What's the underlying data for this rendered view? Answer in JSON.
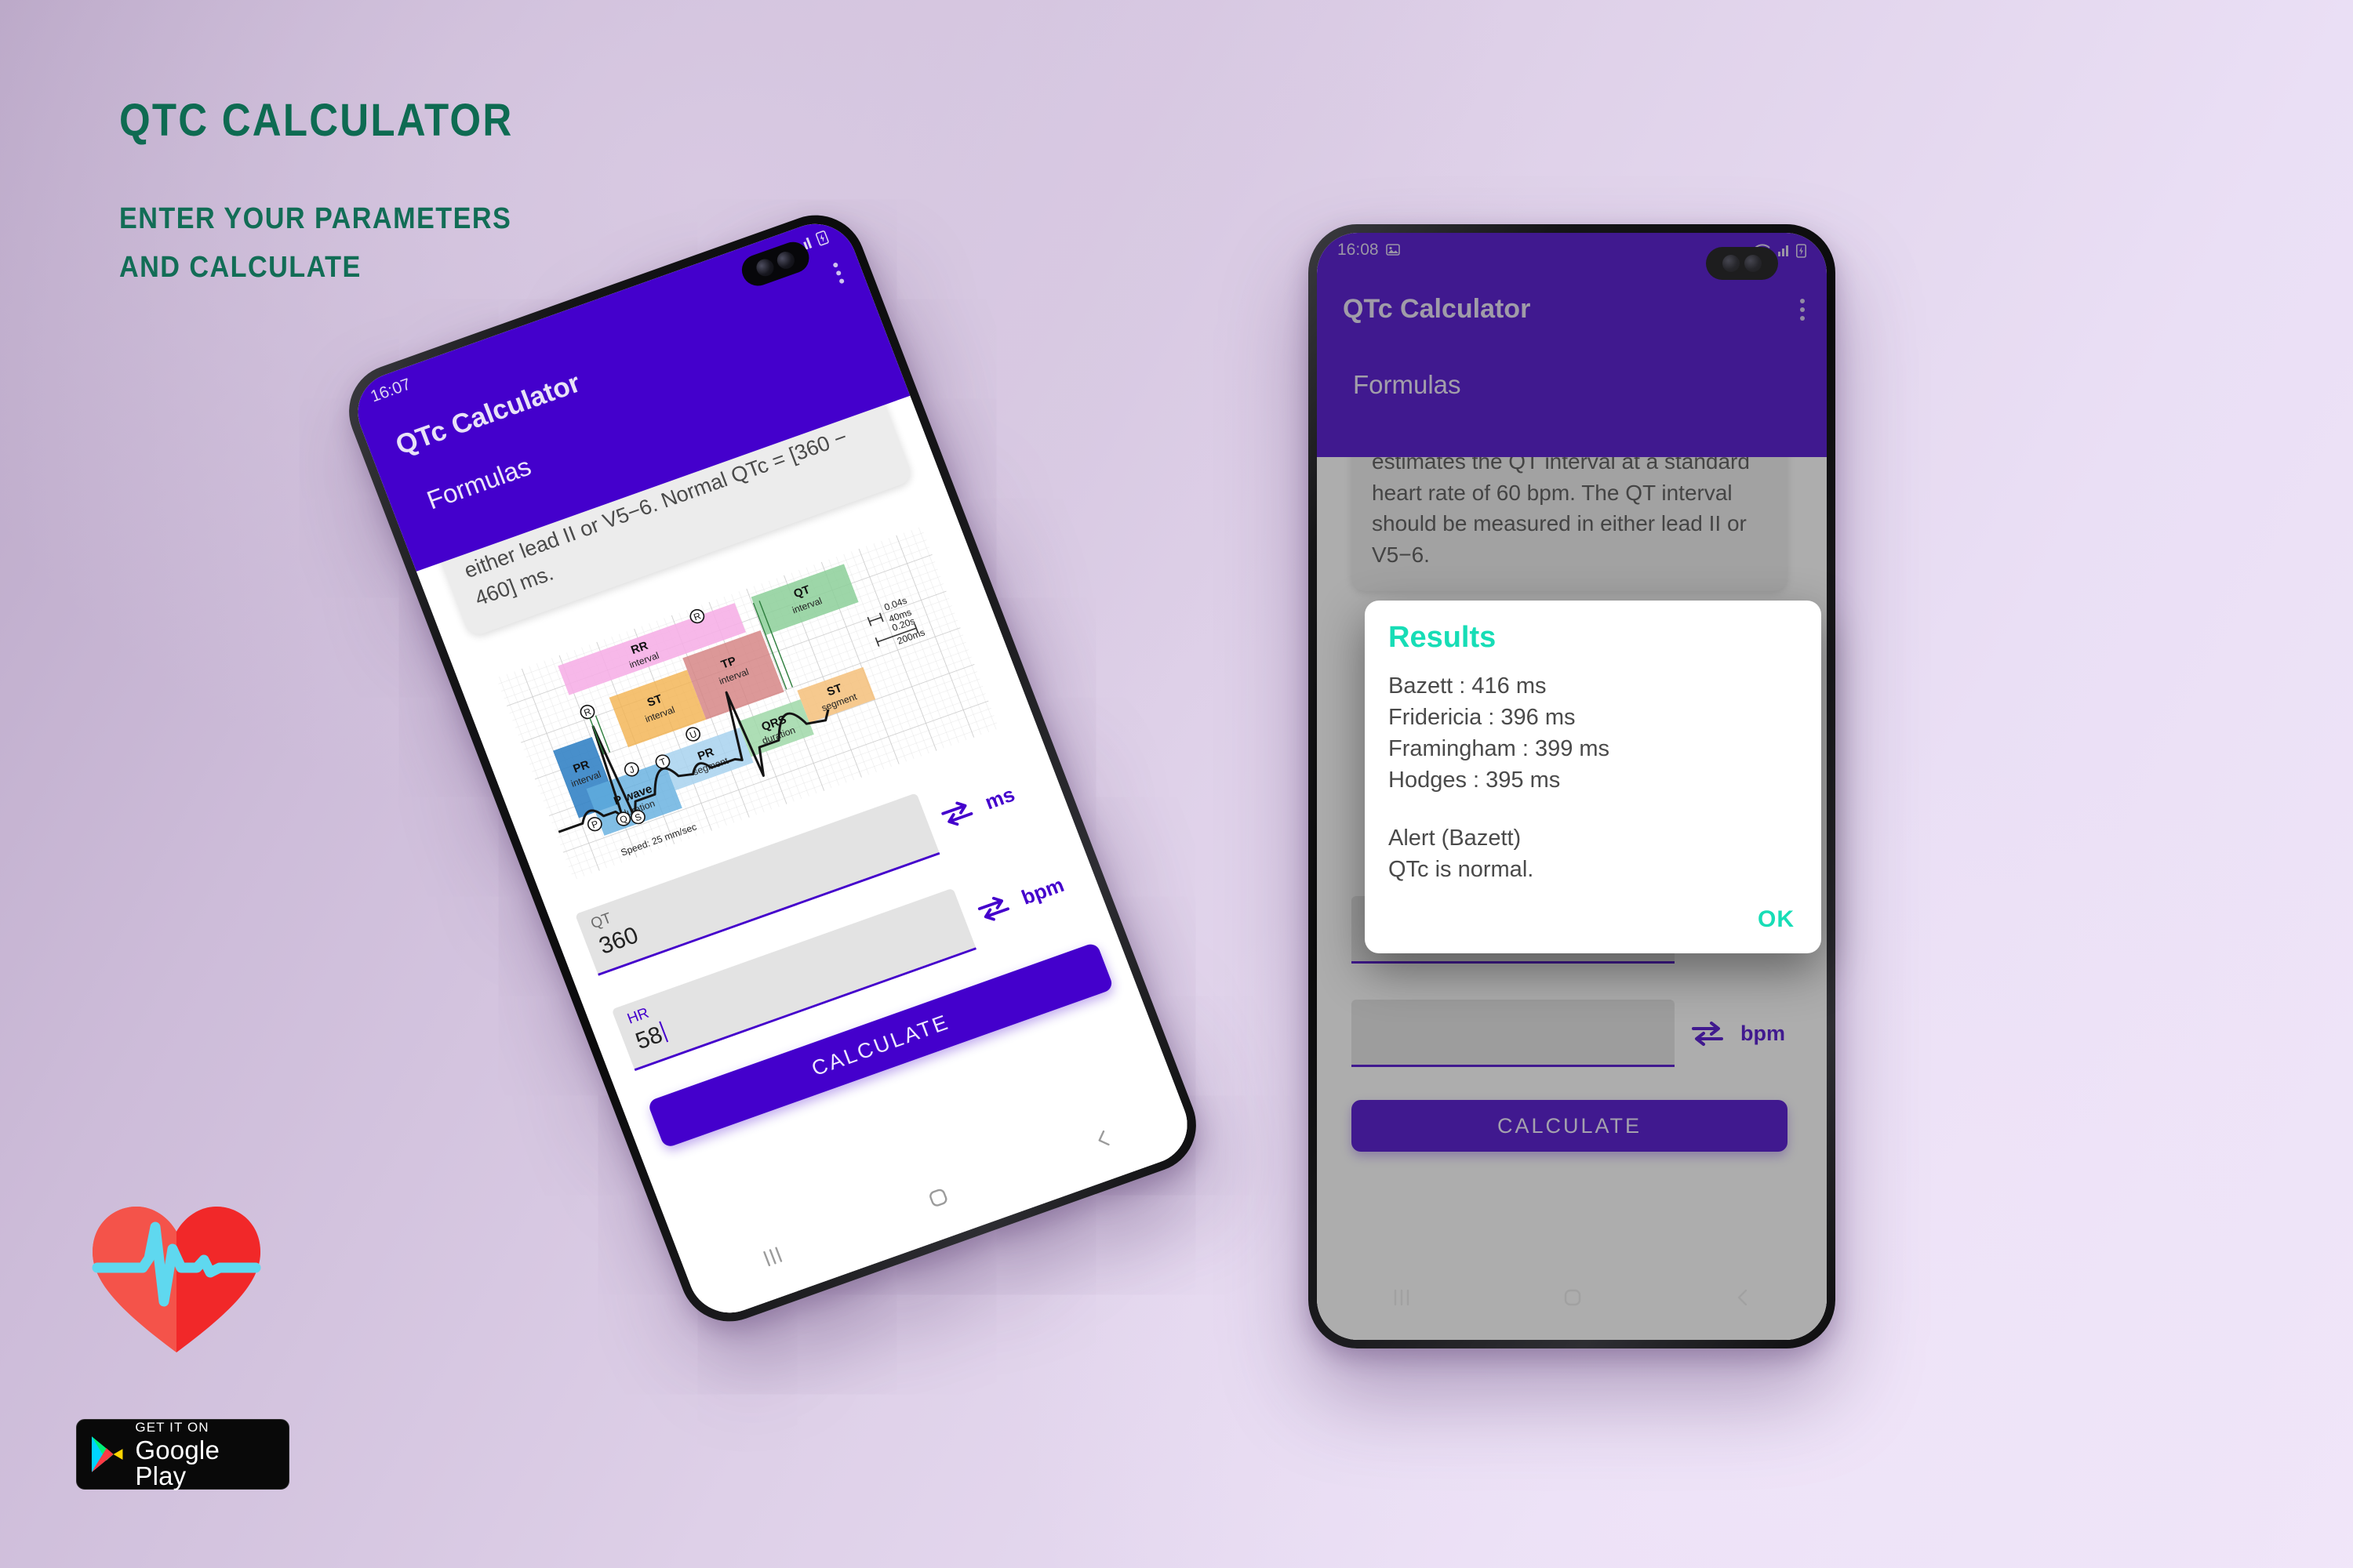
{
  "promo": {
    "title": "QTC CALCULATOR",
    "subtitle_line1": "ENTER YOUR PARAMETERS",
    "subtitle_line2": "AND CALCULATE",
    "title_color": "#0e6b52"
  },
  "badge": {
    "get_it_on": "GET IT ON",
    "store": "Google Play"
  },
  "logo": {
    "name": "heart-pulse-logo",
    "heart_color": "#f4443c",
    "pulse_color": "#5fd8ef"
  },
  "theme": {
    "primary_purple": "#4400CC",
    "accent_teal": "#17ddb6",
    "card_grey": "#ececec",
    "field_grey": "#e3e3e3"
  },
  "phone_left": {
    "status": {
      "time": "16:07",
      "icons": [
        "image-icon",
        "wifi-icon",
        "signal-icon",
        "battery-charging-icon"
      ]
    },
    "appbar": {
      "title": "QTc Calculator",
      "subtitle": "Formulas",
      "overflow": "more-vert-icon"
    },
    "info_text": "The corrected QT interval (QTc) estimates the QT interval at a standard heart rate of 60 bpm. The QT interval should be measured in either lead II or V5−6. Normal QTc = [360 − 460] ms.",
    "fields": [
      {
        "label": "QT",
        "value": "360",
        "unit": "ms",
        "focused": false,
        "swap_icon": "swap-horizontal-icon"
      },
      {
        "label": "HR",
        "value": "58",
        "unit": "bpm",
        "focused": true,
        "swap_icon": "swap-horizontal-icon"
      }
    ],
    "calculate_label": "CALCULATE",
    "nav": [
      "recents-icon",
      "home-icon",
      "back-icon"
    ]
  },
  "phone_right": {
    "status": {
      "time": "16:08",
      "icons": [
        "image-icon",
        "wifi-icon",
        "signal-icon",
        "battery-charging-icon"
      ]
    },
    "appbar": {
      "title": "QTc Calculator",
      "subtitle": "Formulas",
      "overflow": "more-vert-icon"
    },
    "info_text": "The corrected QT interval (QTc) estimates the QT interval at a standard heart rate of 60 bpm. The QT interval should be measured in either lead II or V5−6.",
    "fields": [
      {
        "label": "",
        "value": "",
        "unit": "ms",
        "focused": false,
        "swap_icon": "swap-horizontal-icon"
      },
      {
        "label": "",
        "value": "",
        "unit": "bpm",
        "focused": true,
        "swap_icon": "swap-horizontal-icon"
      }
    ],
    "calculate_label": "CALCULATE",
    "nav": [
      "recents-icon",
      "home-icon",
      "back-icon"
    ],
    "dialog": {
      "title": "Results",
      "lines": [
        "Bazett : 416 ms",
        "Fridericia : 396 ms",
        "Framingham : 399 ms",
        "Hodges : 395 ms"
      ],
      "alert_title": "Alert (Bazett)",
      "alert_text": "QTc is normal.",
      "ok_label": "OK"
    }
  },
  "ecg_diagram": {
    "name": "ecg-intervals-diagram",
    "speed_label": "Speed: 25 mm/sec",
    "scale_small": "0.04s",
    "scale_small_ms": "40ms",
    "scale_large": "0.20s",
    "scale_large_ms": "200ms",
    "bands": [
      {
        "label": "RR",
        "sublabel": "interval",
        "color": "#f7b5e8"
      },
      {
        "label": "QT",
        "sublabel": "interval",
        "color": "#8fd49a"
      },
      {
        "label": "ST",
        "sublabel": "interval",
        "color": "#f5b košice"
      },
      {
        "label": "TP",
        "sublabel": "interval",
        "color": "#d98c8c"
      },
      {
        "label": "PR",
        "sublabel": "interval",
        "color": "#2f7fc4"
      },
      {
        "label": "P wave",
        "sublabel": "duration",
        "color": "#62aede"
      },
      {
        "label": "PR",
        "sublabel": "segment",
        "color": "#a8d2ee"
      },
      {
        "label": "QRS",
        "sublabel": "duration",
        "color": "#9fd8a8"
      },
      {
        "label": "ST",
        "sublabel": "segment",
        "color": "#f5c07a"
      }
    ],
    "markers": [
      "P",
      "Q",
      "R",
      "S",
      "T",
      "U",
      "J"
    ]
  }
}
